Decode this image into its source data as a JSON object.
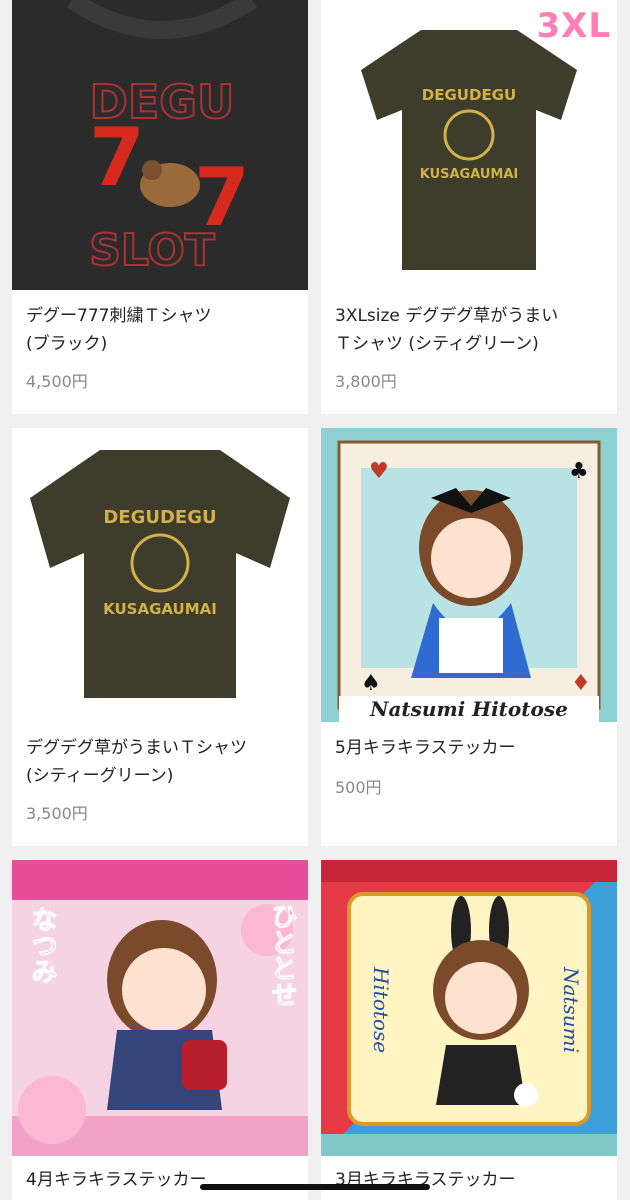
{
  "products": [
    {
      "title_line1": "デグー777刺繍Ｔシャツ",
      "title_line2": "(ブラック)",
      "price": "4,500円",
      "image": "black-embroidered-tshirt",
      "art_top": "DEGU",
      "art_bottom": "SLOT"
    },
    {
      "title_line1": "3XLsize デグデグ草がうまい",
      "title_line2": "Ｔシャツ (シティグリーン)",
      "price": "3,800円",
      "image": "green-tshirt-3xl",
      "badge": "3XL",
      "art_top": "DEGUDEGU",
      "art_bottom": "KUSAGAUMAI"
    },
    {
      "title_line1": "デグデグ草がうまいＴシャツ",
      "title_line2": "(シティーグリーン)",
      "price": "3,500円",
      "image": "green-tshirt",
      "art_top": "DEGUDEGU",
      "art_bottom": "KUSAGAUMAI"
    },
    {
      "title_line1": "5月キラキラステッカー",
      "title_line2": "",
      "price": "500円",
      "image": "alice-sticker",
      "art_bottom": "Natsumi Hitotose"
    },
    {
      "title_line1": "4月キラキラステッカー",
      "title_line2": "",
      "price": "",
      "image": "school-sticker",
      "art_side_a": "ひととせ",
      "art_side_b": "なつみ"
    },
    {
      "title_line1": "3月キラキラステッカー",
      "title_line2": "",
      "price": "",
      "image": "bunny-sticker",
      "art_side_a": "Hitotose",
      "art_side_b": "Natsumi"
    }
  ]
}
